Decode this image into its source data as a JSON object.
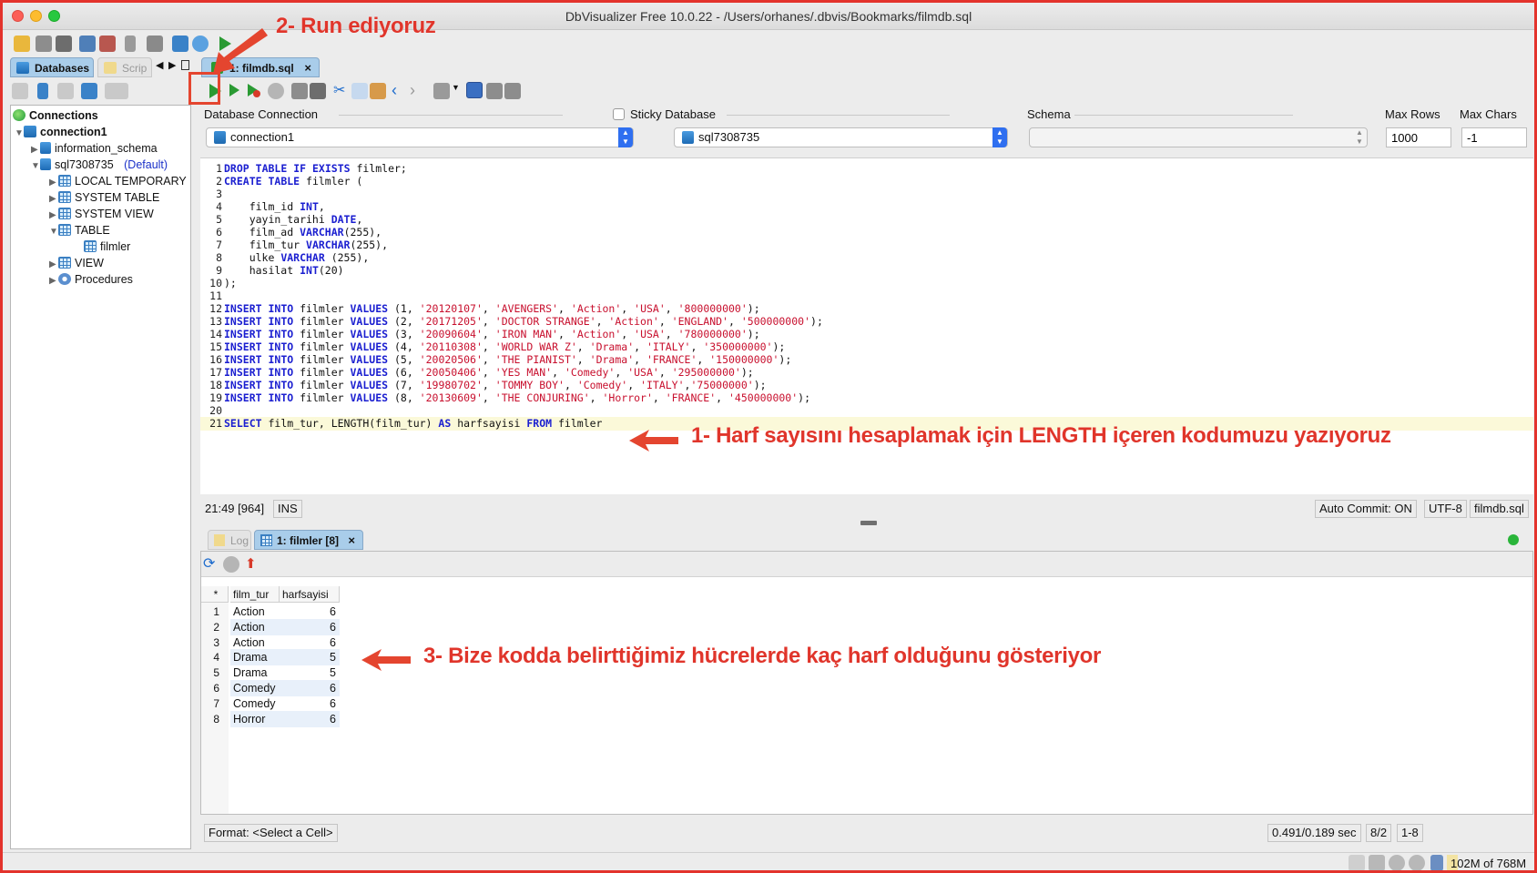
{
  "window": {
    "title": "DbVisualizer Free 10.0.22 - /Users/orhanes/.dbvis/Bookmarks/filmdb.sql"
  },
  "left_tabs": {
    "databases": "Databases",
    "scripts": "Scrip"
  },
  "tree": {
    "root": "Connections",
    "connection": "connection1",
    "schema1": "information_schema",
    "schema2": "sql7308735",
    "default_tag": "(Default)",
    "items": [
      "LOCAL TEMPORARY",
      "SYSTEM TABLE",
      "SYSTEM VIEW",
      "TABLE",
      "filmler",
      "VIEW",
      "Procedures"
    ]
  },
  "editor_tab": {
    "label": "1: filmdb.sql"
  },
  "connection_bar": {
    "db_connection_label": "Database Connection",
    "db_connection_value": "connection1",
    "sticky_label": "Sticky Database",
    "database_value": "sql7308735",
    "schema_label": "Schema",
    "max_rows_label": "Max Rows",
    "max_rows_value": "1000",
    "max_chars_label": "Max Chars",
    "max_chars_value": "-1"
  },
  "code_lines": [
    "1|DROP TABLE IF EXISTS filmler;",
    "2|CREATE TABLE filmler (",
    "3|",
    "4|    film_id INT,",
    "5|    yayin_tarihi DATE,",
    "6|    film_ad VARCHAR(255),",
    "7|    film_tur VARCHAR(255),",
    "8|    ulke VARCHAR (255),",
    "9|    hasilat INT(20)",
    "10|);",
    "11|",
    "12|INSERT INTO filmler VALUES (1, '20120107', 'AVENGERS', 'Action', 'USA', '800000000');",
    "13|INSERT INTO filmler VALUES (2, '20171205', 'DOCTOR STRANGE', 'Action', 'ENGLAND', '500000000');",
    "14|INSERT INTO filmler VALUES (3, '20090604', 'IRON MAN', 'Action', 'USA', '780000000');",
    "15|INSERT INTO filmler VALUES (4, '20110308', 'WORLD WAR Z', 'Drama', 'ITALY', '350000000');",
    "16|INSERT INTO filmler VALUES (5, '20020506', 'THE PIANIST', 'Drama', 'FRANCE', '150000000');",
    "17|INSERT INTO filmler VALUES (6, '20050406', 'YES MAN', 'Comedy', 'USA', '295000000');",
    "18|INSERT INTO filmler VALUES (7, '19980702', 'TOMMY BOY', 'Comedy', 'ITALY','75000000');",
    "19|INSERT INTO filmler VALUES (8, '20130609', 'THE CONJURING', 'Horror', 'FRANCE', '450000000');",
    "20|",
    "21|SELECT film_tur, LENGTH(film_tur) AS harfsayisi FROM filmler"
  ],
  "editor_status": {
    "position": "21:49 [964]",
    "mode": "INS",
    "autocommit": "Auto Commit: ON",
    "encoding": "UTF-8",
    "file": "filmdb.sql"
  },
  "result_tabs": {
    "log": "Log",
    "result": "1: filmler [8]"
  },
  "result_grid": {
    "corner": "*",
    "columns": [
      "film_tur",
      "harfsayisi"
    ],
    "rows": [
      [
        "1",
        "Action",
        "6"
      ],
      [
        "2",
        "Action",
        "6"
      ],
      [
        "3",
        "Action",
        "6"
      ],
      [
        "4",
        "Drama",
        "5"
      ],
      [
        "5",
        "Drama",
        "5"
      ],
      [
        "6",
        "Comedy",
        "6"
      ],
      [
        "7",
        "Comedy",
        "6"
      ],
      [
        "8",
        "Horror",
        "6"
      ]
    ]
  },
  "result_status": {
    "format": "Format: <Select a Cell>",
    "timing": "0.491/0.189 sec",
    "count": "8/2",
    "range": "1-8"
  },
  "memory": {
    "label": "102M of 768M",
    "used_fraction": 0.133
  },
  "annotations": {
    "step1": "1- Harf sayısını hesaplamak için LENGTH içeren kodumuzu yazıyoruz",
    "step2": "2- Run ediyoruz",
    "step3": "3- Bize kodda belirttiğimiz hücrelerde kaç harf olduğunu gösteriyor"
  },
  "colors": {
    "annotation": "#e0352b",
    "keyword": "#1a1ed0",
    "string": "#c8102e",
    "run": "#2a9a33"
  },
  "icons": [
    "folder-open-icon",
    "save-icon",
    "save-all-icon",
    "connect-icon",
    "disconnect-icon",
    "tools-icon",
    "run-icon",
    "stop-icon",
    "refresh-icon",
    "export-icon"
  ]
}
